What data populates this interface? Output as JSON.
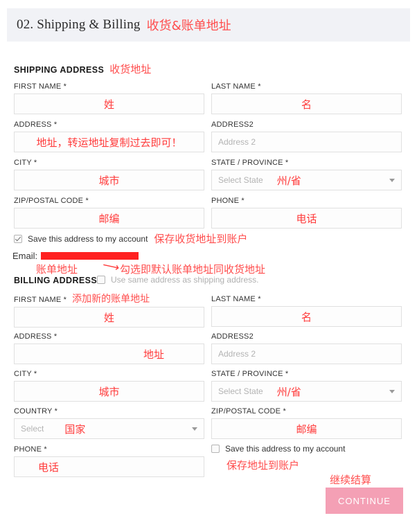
{
  "header": {
    "title": "02. Shipping & Billing",
    "annotation": "收货&账单地址"
  },
  "shipping": {
    "title": "SHIPPING ADDRESS",
    "title_annotation": "收货地址",
    "fields": {
      "first_name": {
        "label": "FIRST NAME *",
        "value": "姓",
        "placeholder": ""
      },
      "last_name": {
        "label": "LAST NAME *",
        "value": "名",
        "placeholder": ""
      },
      "address": {
        "label": "ADDRESS *",
        "value": "地址，转运地址复制过去即可！",
        "placeholder": ""
      },
      "address2": {
        "label": "ADDRESS2",
        "value": "",
        "placeholder": "Address 2"
      },
      "city": {
        "label": "CITY *",
        "value": "城市",
        "placeholder": ""
      },
      "state": {
        "label": "STATE / PROVINCE *",
        "value": "州/省",
        "placeholder": "Select State"
      },
      "zip": {
        "label": "ZIP/POSTAL CODE *",
        "value": "邮编",
        "placeholder": ""
      },
      "phone": {
        "label": "PHONE *",
        "value": "电话",
        "placeholder": ""
      }
    },
    "save_checkbox": {
      "label": "Save this address to my account",
      "annotation": "保存收货地址到账户",
      "checked": true
    },
    "email": {
      "label": "Email:",
      "value": ""
    }
  },
  "billing": {
    "title": "BILLING ADDRESS",
    "title_annotation": "账单地址",
    "same_as_shipping": {
      "label": "Use same address as shipping address.",
      "annotation": "勾选即默认账单地址同收货地址",
      "checked": false
    },
    "new_address_annotation": "添加新的账单地址",
    "fields": {
      "first_name": {
        "label": "FIRST NAME *",
        "value": "姓",
        "placeholder": ""
      },
      "last_name": {
        "label": "LAST NAME *",
        "value": "名",
        "placeholder": ""
      },
      "address": {
        "label": "ADDRESS *",
        "value": "地址",
        "placeholder": ""
      },
      "address2": {
        "label": "ADDRESS2",
        "value": "",
        "placeholder": "Address 2"
      },
      "city": {
        "label": "CITY *",
        "value": "城市",
        "placeholder": ""
      },
      "state": {
        "label": "STATE / PROVINCE *",
        "value": "州/省",
        "placeholder": "Select State"
      },
      "country": {
        "label": "COUNTRY *",
        "value": "国家",
        "placeholder": "Select"
      },
      "zip": {
        "label": "ZIP/POSTAL CODE *",
        "value": "邮编",
        "placeholder": ""
      },
      "phone": {
        "label": "PHONE *",
        "value": "电话",
        "placeholder": ""
      }
    },
    "save_checkbox": {
      "label": "Save this address to my account",
      "annotation": "保存地址到账户",
      "checked": false
    }
  },
  "footer": {
    "continue_label": "CONTINUE",
    "continue_annotation": "继续结算"
  },
  "colors": {
    "header_bg": "#f1f2f6",
    "annotation_red": "#ff4d4d",
    "button_pink": "#f4a0b5",
    "input_border": "#e0e0e0"
  }
}
